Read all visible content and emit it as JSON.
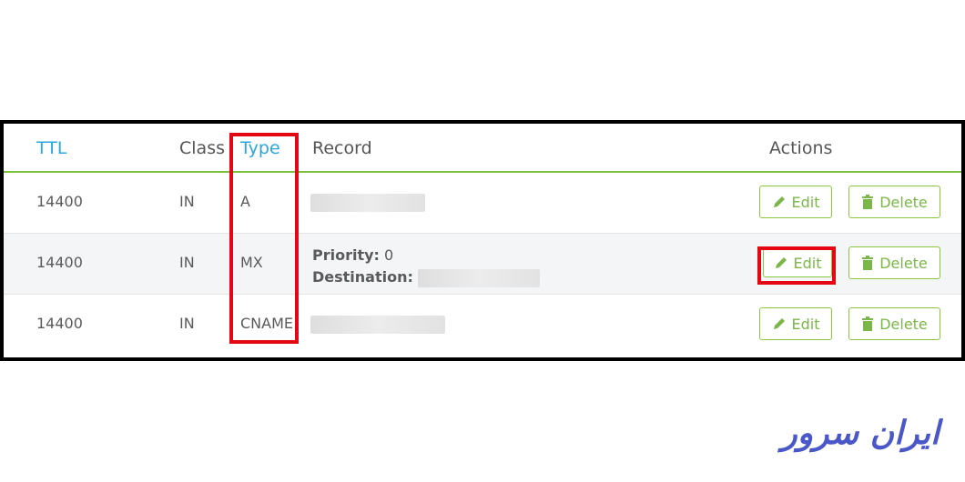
{
  "table": {
    "headers": {
      "ttl": "TTL",
      "class": "Class",
      "type": "Type",
      "record": "Record",
      "actions": "Actions"
    },
    "rows": [
      {
        "ttl": "14400",
        "class": "IN",
        "type": "A"
      },
      {
        "ttl": "14400",
        "class": "IN",
        "type": "MX",
        "priority_label": "Priority:",
        "priority_value": "0",
        "destination_label": "Destination:"
      },
      {
        "ttl": "14400",
        "class": "IN",
        "type": "CNAME"
      }
    ],
    "edit_label": "Edit",
    "delete_label": "Delete"
  },
  "logo": {
    "text": "ایران سرور"
  },
  "colors": {
    "accent_green": "#7ac143",
    "link_blue": "#2aa7df",
    "highlight_red": "#e30613",
    "logo_blue": "#4a57c9"
  },
  "icons": [
    "pencil-icon",
    "trash-icon"
  ]
}
